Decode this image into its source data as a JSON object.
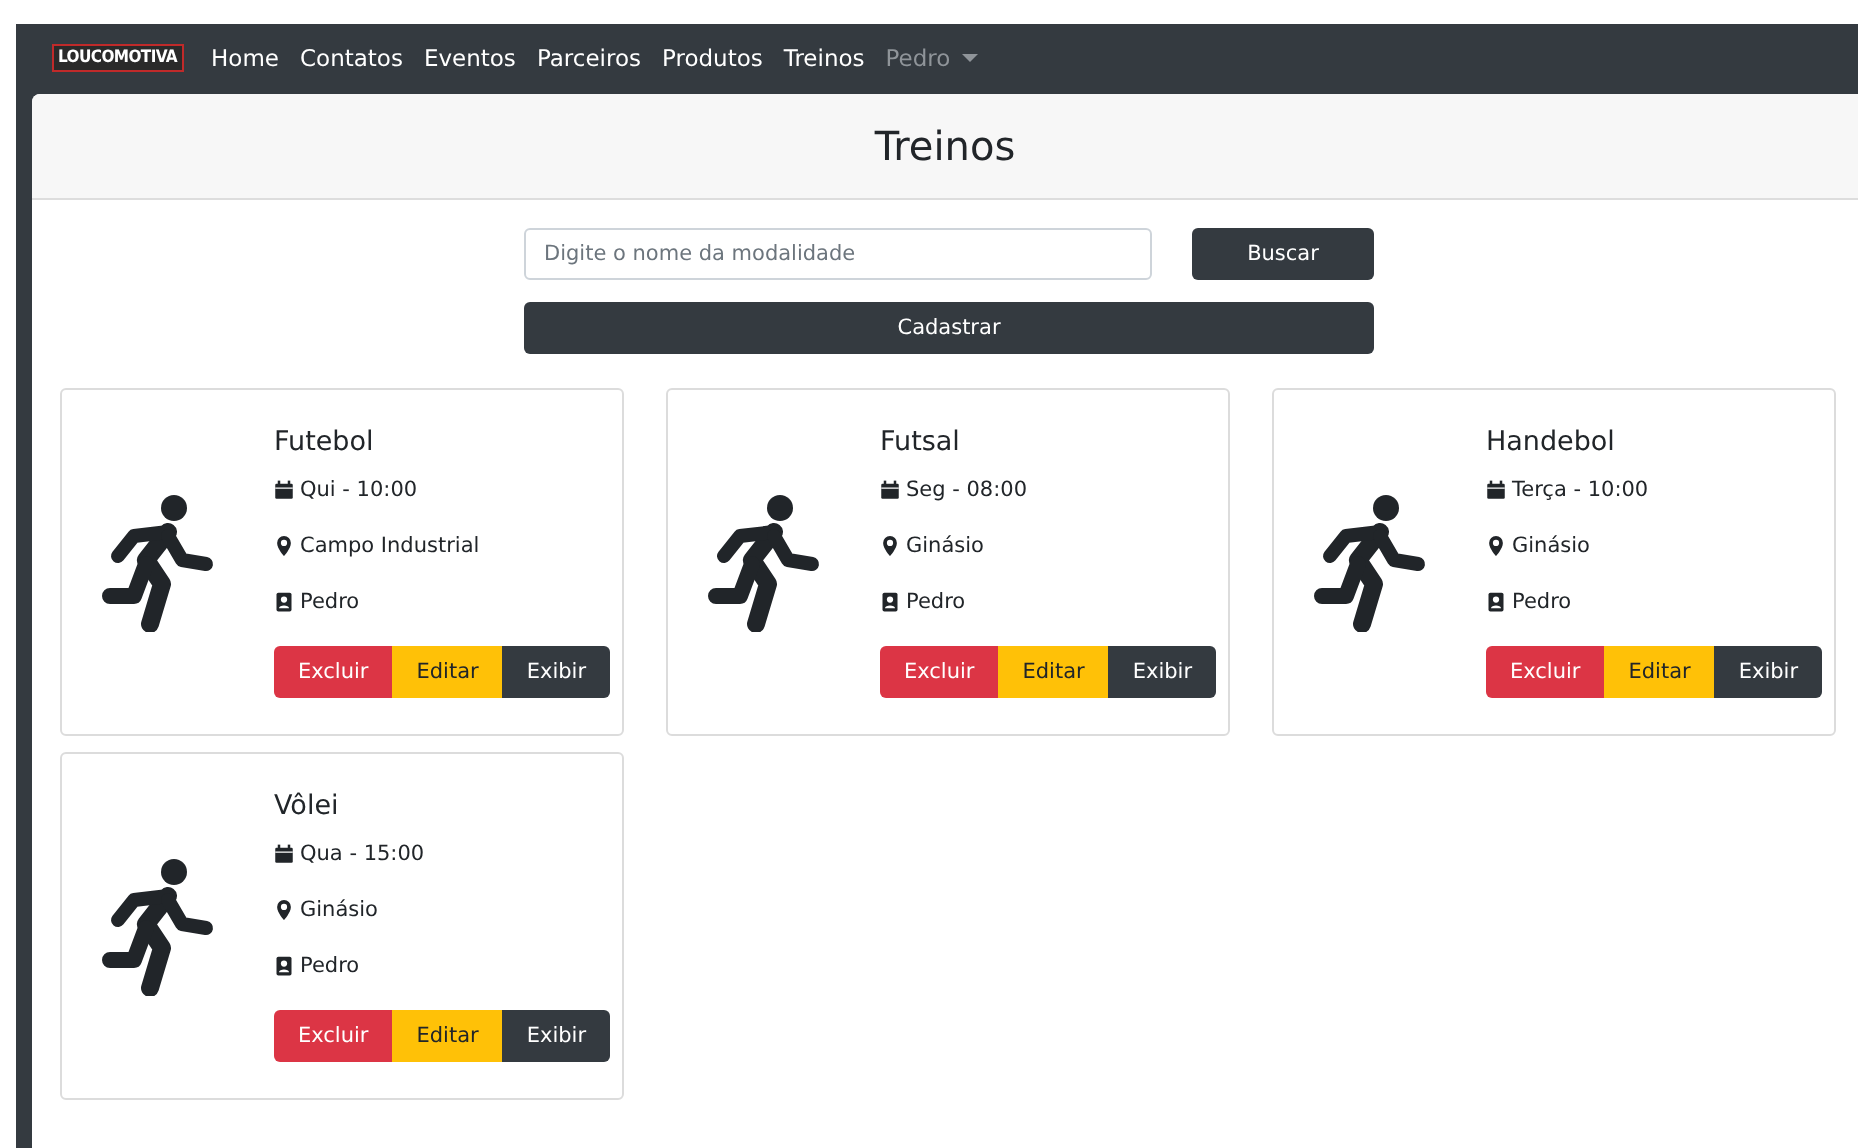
{
  "navbar": {
    "logo": "LOUCOMOTIVA",
    "links": [
      {
        "label": "Home",
        "selected": false
      },
      {
        "label": "Contatos",
        "selected": false
      },
      {
        "label": "Eventos",
        "selected": false
      },
      {
        "label": "Parceiros",
        "selected": false
      },
      {
        "label": "Produtos",
        "selected": false
      },
      {
        "label": "Treinos",
        "selected": false
      }
    ],
    "user_menu": {
      "label": "Pedro",
      "expanded": false
    }
  },
  "page_title": "Treinos",
  "search": {
    "placeholder": "Digite o nome da modalidade",
    "button": "Buscar"
  },
  "register_button": "Cadastrar",
  "cards": [
    {
      "title": "Futebol",
      "schedule": "Qui - 10:00",
      "place": "Campo Industrial",
      "coach": "Pedro",
      "buttons": [
        {
          "label": "Excluir",
          "kind": "danger"
        },
        {
          "label": "Editar",
          "kind": "warning"
        },
        {
          "label": "Exibir",
          "kind": "dark"
        }
      ]
    },
    {
      "title": "Futsal",
      "schedule": "Seg - 08:00",
      "place": "Ginásio",
      "coach": "Pedro",
      "buttons": [
        {
          "label": "Excluir",
          "kind": "danger"
        },
        {
          "label": "Editar",
          "kind": "warning"
        },
        {
          "label": "Exibir",
          "kind": "dark"
        }
      ]
    },
    {
      "title": "Handebol",
      "schedule": "Terça - 10:00",
      "place": "Ginásio",
      "coach": "Pedro",
      "buttons": [
        {
          "label": "Excluir",
          "kind": "danger"
        },
        {
          "label": "Editar",
          "kind": "warning"
        },
        {
          "label": "Exibir",
          "kind": "dark"
        }
      ]
    },
    {
      "title": "Vôlei",
      "schedule": "Qua - 15:00",
      "place": "Ginásio",
      "coach": "Pedro",
      "buttons": [
        {
          "label": "Excluir",
          "kind": "danger"
        },
        {
          "label": "Editar",
          "kind": "warning"
        },
        {
          "label": "Exibir",
          "kind": "dark"
        }
      ]
    }
  ]
}
